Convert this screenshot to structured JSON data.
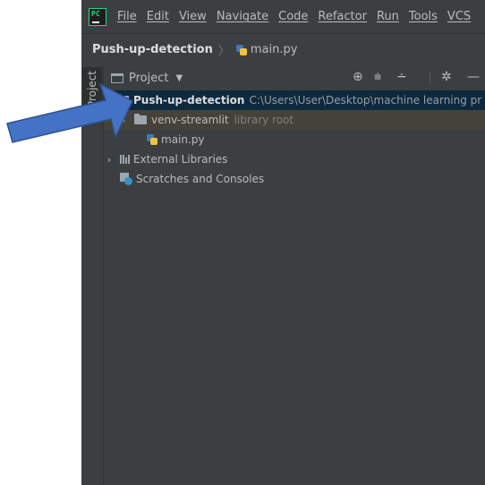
{
  "menubar": {
    "logo_text": "PC",
    "items": [
      "File",
      "Edit",
      "View",
      "Navigate",
      "Code",
      "Refactor",
      "Run",
      "Tools",
      "VCS"
    ]
  },
  "breadcrumb": {
    "project": "Push-up-detection",
    "separator": "〉",
    "file": "main.py"
  },
  "toolstrip": {
    "tab_label": "Project"
  },
  "project_panel": {
    "title": "Project",
    "tree": {
      "root": {
        "name": "Push-up-detection",
        "path": "C:\\Users\\User\\Desktop\\machine learning pr"
      },
      "venv": {
        "name": "venv-streamlit",
        "tag": "library root"
      },
      "file": "main.py",
      "external": "External Libraries",
      "scratches": "Scratches and Consoles"
    }
  },
  "colors": {
    "background": "#3c3f41",
    "selected_row": "#0d293e",
    "library_row": "#45423a",
    "callout_arrow": "#4472c4"
  },
  "icons": [
    "pycharm-logo-icon",
    "python-file-icon",
    "folder-icon",
    "chevron-down-icon",
    "chevron-right-icon",
    "crosshair-icon",
    "expand-all-icon",
    "collapse-all-icon",
    "gear-icon",
    "minimize-icon",
    "external-libraries-icon",
    "scratches-icon"
  ]
}
